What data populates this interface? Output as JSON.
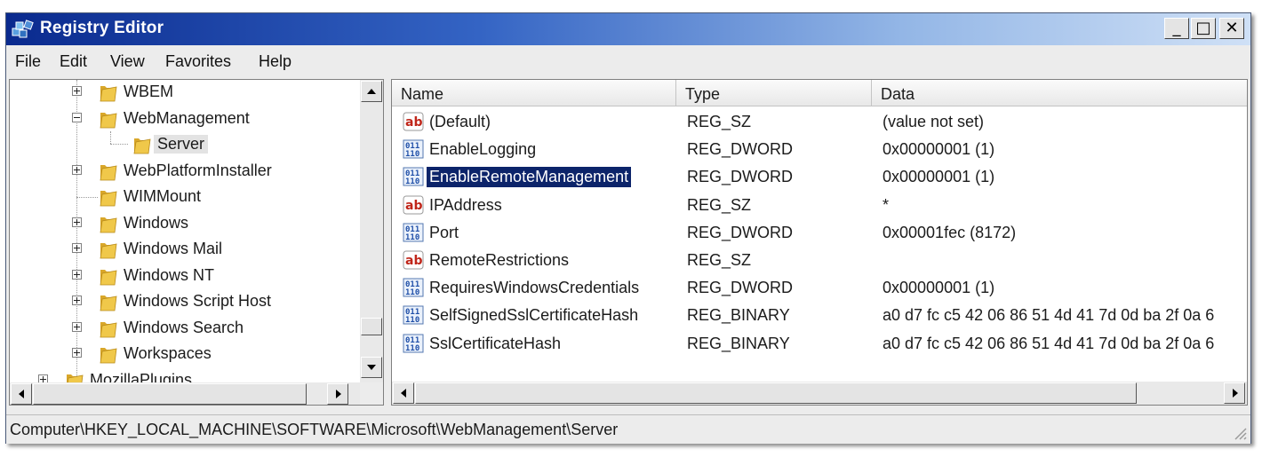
{
  "window": {
    "title": "Registry Editor"
  },
  "caption_buttons": {
    "minimize": "_",
    "maximize": "□",
    "close": "✕"
  },
  "menu": [
    {
      "label": "File"
    },
    {
      "label": "Edit"
    },
    {
      "label": "View"
    },
    {
      "label": "Favorites"
    },
    {
      "label": "Help"
    }
  ],
  "tree": {
    "nodes": [
      {
        "label": "WBEM",
        "expander": "plus",
        "level": 1
      },
      {
        "label": "WebManagement",
        "expander": "minus",
        "level": 1
      },
      {
        "label": "Server",
        "expander": "none",
        "level": 2,
        "selected": true
      },
      {
        "label": "WebPlatformInstaller",
        "expander": "plus",
        "level": 1
      },
      {
        "label": "WIMMount",
        "expander": "none",
        "level": 1
      },
      {
        "label": "Windows",
        "expander": "plus",
        "level": 1
      },
      {
        "label": "Windows Mail",
        "expander": "plus",
        "level": 1
      },
      {
        "label": "Windows NT",
        "expander": "plus",
        "level": 1
      },
      {
        "label": "Windows Script Host",
        "expander": "plus",
        "level": 1
      },
      {
        "label": "Windows Search",
        "expander": "plus",
        "level": 1
      },
      {
        "label": "Workspaces",
        "expander": "plus",
        "level": 1
      },
      {
        "label": "MozillaPlugins",
        "expander": "plus",
        "level": 0
      }
    ]
  },
  "list": {
    "columns": [
      {
        "label": "Name"
      },
      {
        "label": "Type"
      },
      {
        "label": "Data"
      }
    ],
    "rows": [
      {
        "icon": "string-value-icon",
        "name": "(Default)",
        "type": "REG_SZ",
        "data": "(value not set)"
      },
      {
        "icon": "binary-value-icon",
        "name": "EnableLogging",
        "type": "REG_DWORD",
        "data": "0x00000001 (1)"
      },
      {
        "icon": "binary-value-icon",
        "name": "EnableRemoteManagement",
        "type": "REG_DWORD",
        "data": "0x00000001 (1)",
        "selected": true
      },
      {
        "icon": "string-value-icon",
        "name": "IPAddress",
        "type": "REG_SZ",
        "data": "*"
      },
      {
        "icon": "binary-value-icon",
        "name": "Port",
        "type": "REG_DWORD",
        "data": "0x00001fec (8172)"
      },
      {
        "icon": "string-value-icon",
        "name": "RemoteRestrictions",
        "type": "REG_SZ",
        "data": ""
      },
      {
        "icon": "binary-value-icon",
        "name": "RequiresWindowsCredentials",
        "type": "REG_DWORD",
        "data": "0x00000001 (1)"
      },
      {
        "icon": "binary-value-icon",
        "name": "SelfSignedSslCertificateHash",
        "type": "REG_BINARY",
        "data": "a0 d7 fc c5 42 06 86 51 4d 41 7d 0d ba 2f 0a 6"
      },
      {
        "icon": "binary-value-icon",
        "name": "SslCertificateHash",
        "type": "REG_BINARY",
        "data": "a0 d7 fc c5 42 06 86 51 4d 41 7d 0d ba 2f 0a 6"
      }
    ]
  },
  "status": {
    "path": "Computer\\HKEY_LOCAL_MACHINE\\SOFTWARE\\Microsoft\\WebManagement\\Server"
  },
  "colors": {
    "selection": "#0c246a",
    "titlebar_start": "#0a2a8e",
    "titlebar_end": "#cfe0f6",
    "folder": "#f0c84a"
  }
}
